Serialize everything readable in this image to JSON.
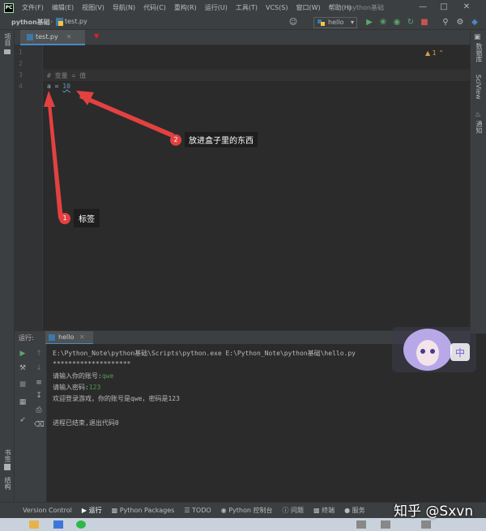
{
  "menubar": {
    "logo": "PC",
    "items": [
      "文件(F)",
      "编辑(E)",
      "视图(V)",
      "导航(N)",
      "代码(C)",
      "重构(R)",
      "运行(U)",
      "工具(T)",
      "VCS(S)",
      "窗口(W)",
      "帮助(H)"
    ],
    "window_title": "python基础"
  },
  "navbar": {
    "project": "python基础",
    "file": "test.py",
    "run_config": "hello"
  },
  "editor": {
    "tab_label": "test.py",
    "line_numbers": [
      "1",
      "2",
      "3",
      "4"
    ],
    "code": {
      "line3_comment": "# 变量 = 值",
      "line4_var": "a",
      "line4_eq": " = ",
      "line4_val": "10"
    },
    "inspection_count": "1"
  },
  "annotations": [
    {
      "badge": "1",
      "text": "标签"
    },
    {
      "badge": "2",
      "text": "放进盒子里的东西"
    }
  ],
  "right_strip": [
    "数据库",
    "SciView",
    "通知"
  ],
  "left_strip": [
    "项目",
    "书签",
    "结构"
  ],
  "run_window": {
    "label": "运行:",
    "tab": "hello",
    "console": {
      "command": "E:\\Python_Note\\python基础\\Scripts\\python.exe E:\\Python_Note\\python基础\\hello.py",
      "stars": "********************",
      "account_prompt": "请输入你的账号:",
      "account_input": "qwe",
      "password_prompt": "请输入密码:",
      "password_input": "123",
      "welcome": "欢迎登录游戏，你的账号是qwe，密码是123",
      "exit": "进程已结束,退出代码0"
    }
  },
  "bottombar": {
    "items": [
      "Version Control",
      "运行",
      "Python Packages",
      "TODO",
      "Python 控制台",
      "问题",
      "终端",
      "服务"
    ]
  },
  "watermark": "知乎 @Sxvn",
  "overlay_text": "中",
  "colors": {
    "keyword_value": "#6897bb",
    "comment": "#808080",
    "input_green": "#499c54",
    "arrow_red": "#e34141"
  }
}
